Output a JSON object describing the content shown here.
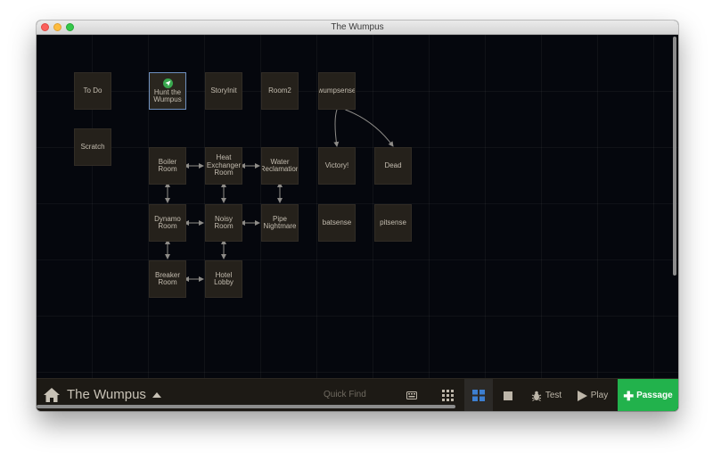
{
  "window": {
    "title": "The Wumpus"
  },
  "passages": [
    {
      "id": "todo",
      "name": "To Do"
    },
    {
      "id": "hunt",
      "name": "Hunt the\nWumpus",
      "start": true,
      "selected": true
    },
    {
      "id": "storyinit",
      "name": "StoryInit"
    },
    {
      "id": "room2",
      "name": "Room2"
    },
    {
      "id": "wumpsense",
      "name": "wumpsense"
    },
    {
      "id": "scratch",
      "name": "Scratch"
    },
    {
      "id": "boiler",
      "name": "Boiler\nRoom"
    },
    {
      "id": "heatex",
      "name": "Heat\nExchanger\nRoom"
    },
    {
      "id": "water",
      "name": "Water\nReclamation"
    },
    {
      "id": "victory",
      "name": "Victory!"
    },
    {
      "id": "dead",
      "name": "Dead"
    },
    {
      "id": "dynamo",
      "name": "Dynamo\nRoom"
    },
    {
      "id": "noisy",
      "name": "Noisy\nRoom"
    },
    {
      "id": "pipe",
      "name": "Pipe\nNightmare"
    },
    {
      "id": "batsense",
      "name": "batsense"
    },
    {
      "id": "pitsense",
      "name": "pitsense"
    },
    {
      "id": "breaker",
      "name": "Breaker\nRoom"
    },
    {
      "id": "hotel",
      "name": "Hotel\nLobby"
    }
  ],
  "links": [
    {
      "from": "wumpsense",
      "to": "victory",
      "type": "one-way"
    },
    {
      "from": "wumpsense",
      "to": "dead",
      "type": "one-way"
    },
    {
      "from": "boiler",
      "to": "heatex",
      "type": "two-way"
    },
    {
      "from": "heatex",
      "to": "water",
      "type": "two-way"
    },
    {
      "from": "boiler",
      "to": "dynamo",
      "type": "two-way"
    },
    {
      "from": "heatex",
      "to": "noisy",
      "type": "two-way"
    },
    {
      "from": "water",
      "to": "pipe",
      "type": "two-way"
    },
    {
      "from": "dynamo",
      "to": "noisy",
      "type": "two-way"
    },
    {
      "from": "noisy",
      "to": "pipe",
      "type": "two-way"
    },
    {
      "from": "dynamo",
      "to": "breaker",
      "type": "two-way"
    },
    {
      "from": "breaker",
      "to": "hotel",
      "type": "two-way"
    },
    {
      "from": "noisy",
      "to": "hotel",
      "type": "two-way"
    }
  ],
  "toolbar": {
    "home_icon": "home-icon",
    "story_title": "The Wumpus",
    "story_menu_icon": "triangle-up-icon",
    "quick_find_placeholder": "Quick Find",
    "buttons": {
      "highlight_icon": "keyboard-icon",
      "zoom_grid_icon": "grid-small-icon",
      "zoom_tiles_icon": "grid-large-icon",
      "zoom_titles_icon": "square-icon",
      "test_label": "Test",
      "test_icon": "bug-icon",
      "play_label": "Play",
      "play_icon": "play-icon",
      "passage_label": "Passage",
      "passage_icon": "plus-icon"
    }
  },
  "colors": {
    "canvas_bg": "#05070d",
    "passage_bg": "#25211b",
    "passage_text": "#c4bdb0",
    "link": "#8e8c88",
    "toolbar_bg": "#1d1a15",
    "accent_blue": "#3d7fd0",
    "passage_button": "#22b24c",
    "start_marker": "#39a84f"
  }
}
